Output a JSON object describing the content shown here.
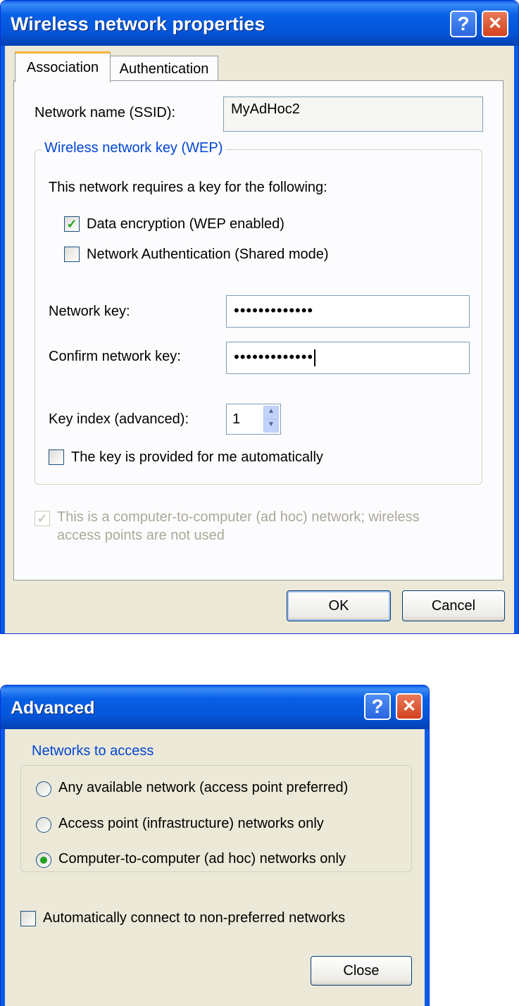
{
  "wireless_dialog": {
    "title": "Wireless network properties",
    "tabs": [
      {
        "label": "Association",
        "selected": true
      },
      {
        "label": "Authentication",
        "selected": false
      }
    ],
    "ssid_label": "Network name (SSID):",
    "ssid_value": "MyAdHoc2",
    "wep_group_legend": "Wireless network key (WEP)",
    "requires_key_text": "This network requires a key for the following:",
    "data_encryption_label": "Data encryption (WEP enabled)",
    "data_encryption_checked": true,
    "network_auth_label": "Network Authentication (Shared mode)",
    "network_auth_checked": false,
    "network_key_label": "Network key:",
    "network_key_value": "•••••••••••••",
    "confirm_key_label": "Confirm network key:",
    "confirm_key_value": "•••••••••••••",
    "key_index_label": "Key index (advanced):",
    "key_index_value": "1",
    "key_auto_label": "The key is provided for me automatically",
    "key_auto_checked": false,
    "adhoc_label_line1": "This is a computer-to-computer (ad hoc) network; wireless",
    "adhoc_label_line2": "access points are not used",
    "adhoc_checked": true,
    "ok_label": "OK",
    "cancel_label": "Cancel",
    "help_glyph": "?",
    "close_glyph": "✕"
  },
  "advanced_dialog": {
    "title": "Advanced",
    "group_legend": "Networks to access",
    "options": [
      {
        "label": "Any available network (access point preferred)",
        "selected": false
      },
      {
        "label": "Access point (infrastructure) networks only",
        "selected": false
      },
      {
        "label": "Computer-to-computer (ad hoc) networks only",
        "selected": true
      }
    ],
    "auto_connect_label": "Automatically connect to non-preferred networks",
    "auto_connect_checked": false,
    "close_button_label": "Close",
    "help_glyph": "?",
    "close_glyph": "✕"
  },
  "colors": {
    "title_bar": "#0a5ce6",
    "dialog_bg": "#ece9d8",
    "group_legend": "#0046d5",
    "check_mark": "#21a121",
    "tab_highlight": "#f9b33e"
  },
  "icons": [
    "help-icon",
    "close-icon",
    "check-icon",
    "spin-up-icon",
    "spin-down-icon",
    "radio-dot-icon"
  ]
}
